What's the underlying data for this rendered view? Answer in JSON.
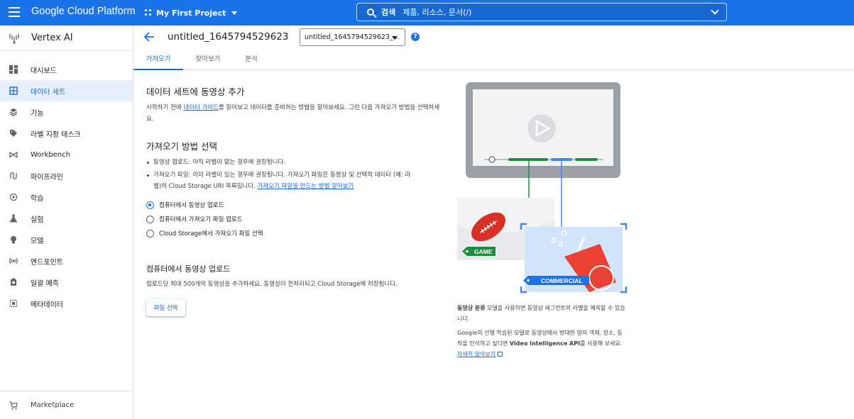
{
  "topbar": {
    "brand": "Google Cloud Platform",
    "project": "My First Project",
    "search_label": "검색",
    "search_placeholder": "제품, 리소스, 문서(/)"
  },
  "sidebar": {
    "product": "Vertex AI",
    "items": [
      {
        "label": "대시보드",
        "icon": "dashboard-icon"
      },
      {
        "label": "데이터 세트",
        "icon": "dataset-icon",
        "active": true
      },
      {
        "label": "기능",
        "icon": "features-icon"
      },
      {
        "label": "라벨 지정 태스크",
        "icon": "label-icon"
      },
      {
        "label": "Workbench",
        "icon": "workbench-icon"
      },
      {
        "label": "파이프라인",
        "icon": "pipeline-icon"
      },
      {
        "label": "학습",
        "icon": "training-icon"
      },
      {
        "label": "실험",
        "icon": "experiment-icon"
      },
      {
        "label": "모델",
        "icon": "model-icon"
      },
      {
        "label": "엔드포인트",
        "icon": "endpoint-icon"
      },
      {
        "label": "일괄 예측",
        "icon": "batch-prediction-icon"
      },
      {
        "label": "메타데이터",
        "icon": "metadata-icon"
      }
    ],
    "marketplace": "Marketplace"
  },
  "header": {
    "title": "untitled_1645794529623",
    "dataset_select": "untitled_1645794529623_..."
  },
  "tabs": [
    "가져오기",
    "찾아보기",
    "분석"
  ],
  "main": {
    "add_title": "데이터 세트에 동영상 추가",
    "intro_before": "시작하기 전에 ",
    "intro_link": "데이터 가이드",
    "intro_after": "를 읽어보고 데이터를 준비하는 방법을 알아보세요. 그런 다음 가져오기 방법을 선택하세요.",
    "method_title": "가져오기 방법 선택",
    "bullet1": "동영상 업로드: 아직 라벨이 없는 경우에 권장됩니다.",
    "bullet2_text": "가져오기 파일: 이미 라벨이 있는 경우에 권장됩니다. 가져오기 파일은 동영상 및 선택적 데이터 (예: 라벨)의 Cloud Storage URI 목록입니다. ",
    "bullet2_link": "가져오기 파일을 만드는 방법 알아보기",
    "radio_options": [
      "컴퓨터에서 동영상 업로드",
      "컴퓨터에서 가져오기 파일 업로드",
      "Cloud Storage에서 가져오기 파일 선택"
    ],
    "selected_option": 0,
    "upload_title": "컴퓨터에서 동영상 업로드",
    "upload_desc": "업로드당 최대 500개의 동영상을 추가하세요. 동영상이 전처리되고 Cloud Storage에 저장됩니다.",
    "select_file_button": "파일 선택"
  },
  "illustration": {
    "tag_game": "GAME",
    "tag_commercial": "COMMERCIAL"
  },
  "notes": {
    "classification_bold": "동영상 분류",
    "classification_text": " 모델을 사용하면 동영상 세그먼트의 라벨을 예측할 수 있습니다.",
    "google_text1": "Google의 선행 학습된 모델로 동영상에서 방대한 양의 객체, 장소, 동작을 인식하고 싶다면 ",
    "google_bold": "Video Intelligence API",
    "google_text2": "를 사용해 보세요. ",
    "learn_more": "자세히 알아보기"
  },
  "colors": {
    "brand_blue": "#1a73e8",
    "active_nav_bg": "#e8f0fe",
    "tag_green": "#1e8e3e",
    "tag_blue": "#1a73e8",
    "ball_red": "#d93025",
    "cup_red": "#ea4335"
  }
}
